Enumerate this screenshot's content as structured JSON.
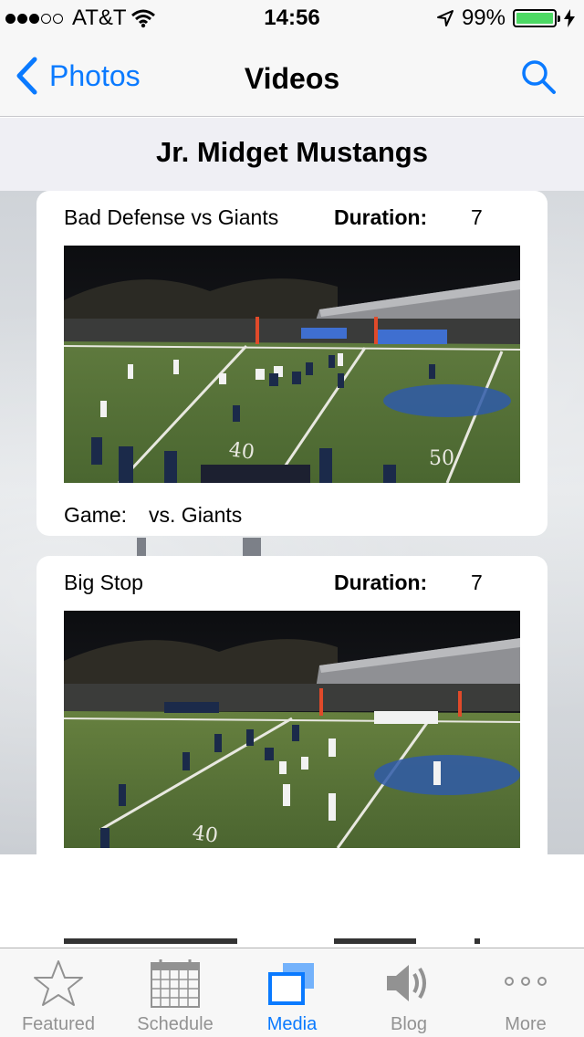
{
  "status_bar": {
    "carrier": "AT&T",
    "time": "14:56",
    "battery_percent": "99%",
    "battery_level": 0.99,
    "signal_bars_filled": 3,
    "signal_bars_total": 5
  },
  "nav": {
    "back_label": "Photos",
    "title": "Videos",
    "accent_color": "#0a7aff"
  },
  "section": {
    "title": "Jr. Midget Mustangs"
  },
  "videos": [
    {
      "title": "Bad Defense vs Giants",
      "duration_label": "Duration:",
      "duration_value": "7",
      "game_label": "Game:",
      "game_value": "vs. Giants"
    },
    {
      "title": "Big Stop",
      "duration_label": "Duration:",
      "duration_value": "7"
    }
  ],
  "tabs": [
    {
      "label": "Featured",
      "icon": "star-icon",
      "active": false
    },
    {
      "label": "Schedule",
      "icon": "calendar-icon",
      "active": false
    },
    {
      "label": "Media",
      "icon": "media-icon",
      "active": true
    },
    {
      "label": "Blog",
      "icon": "speaker-icon",
      "active": false
    },
    {
      "label": "More",
      "icon": "more-dots-icon",
      "active": false
    }
  ]
}
